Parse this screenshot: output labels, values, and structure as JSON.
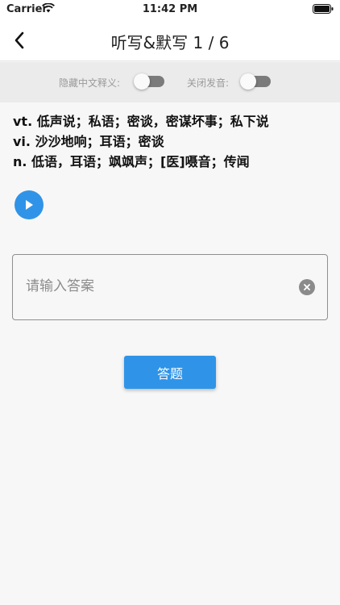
{
  "status_bar": {
    "carrier": "Carrier",
    "time": "11:42 PM",
    "wifi_icon": "wifi-icon",
    "battery_icon": "battery-icon"
  },
  "nav": {
    "back_icon": "chevron-left-icon",
    "title": "听写&默写 1 / 6"
  },
  "settings": {
    "hide_chinese_label": "隐藏中文释义:",
    "hide_chinese_on": false,
    "mute_label": "关闭发音:",
    "mute_on": false
  },
  "definitions": [
    "vt. 低声说；私语；密谈，密谋坏事；私下说",
    "vi. 沙沙地响；耳语；密谈",
    "n. 低语，耳语；飒飒声；[医]嗫音；传闻"
  ],
  "play_icon": "play-icon",
  "answer": {
    "value": "",
    "placeholder": "请输入答案",
    "clear_icon": "clear-icon"
  },
  "submit_label": "答题",
  "colors": {
    "accent": "#2f94e8",
    "background": "#f7f7f7",
    "settings_bar": "#ebebeb"
  }
}
